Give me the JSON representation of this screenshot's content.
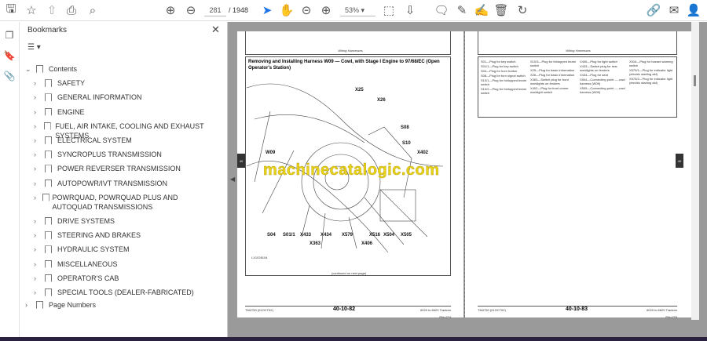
{
  "toolbar": {
    "page_current": "281",
    "page_total": "/ 1948",
    "zoom": "53%",
    "icons": [
      "save-icon",
      "bookmark-star-icon",
      "upload-icon",
      "print-icon",
      "search-icon",
      "page-up-icon",
      "page-down-icon",
      "select-cursor-icon",
      "hand-icon",
      "zoom-out-icon",
      "zoom-in-icon",
      "fit-page-icon",
      "scroll-mode-icon",
      "comment-icon",
      "pen-icon",
      "sign-icon",
      "delete-icon",
      "rotate-icon",
      "share-link-icon",
      "mail-icon",
      "account-icon"
    ],
    "accent": "#1a73e8"
  },
  "panel": {
    "title": "Bookmarks",
    "items": [
      {
        "label": "Contents",
        "level": 0,
        "expanded": true
      },
      {
        "label": "SAFETY",
        "level": 1
      },
      {
        "label": "GENERAL INFORMATION",
        "level": 1
      },
      {
        "label": "ENGINE",
        "level": 1
      },
      {
        "label": "FUEL, AIR INTAKE, COOLING AND EXHAUST SYSTEMS",
        "level": 1
      },
      {
        "label": "ELECTRICAL SYSTEM",
        "level": 1
      },
      {
        "label": "SYNCROPLUS TRANSMISSION",
        "level": 1
      },
      {
        "label": "POWER REVERSER TRANSMISSION",
        "level": 1
      },
      {
        "label": "AUTOPOWR/IVT TRANSMISSION",
        "level": 1
      },
      {
        "label": "POWRQUAD, POWRQUAD PLUS AND AUTOQUAD TRANSMISSIONS",
        "level": 1
      },
      {
        "label": "DRIVE SYSTEMS",
        "level": 1
      },
      {
        "label": "STEERING AND BRAKES",
        "level": 1
      },
      {
        "label": "HYDRAULIC SYSTEM",
        "level": 1
      },
      {
        "label": "MISCELLANEOUS",
        "level": 1
      },
      {
        "label": "OPERATOR'S CAB",
        "level": 1
      },
      {
        "label": "SPECIAL TOOLS (DEALER-FABRICATED)",
        "level": 1
      },
      {
        "label": "Page Numbers",
        "level": 0
      }
    ]
  },
  "left_page": {
    "header": "Wiring Harnesses",
    "title": "Removing and Installing Harness W09 — Cowl, with Stage I Engine to 97/68/EC (Open Operator's Station)",
    "labels": [
      "X25",
      "X26",
      "S08",
      "S10",
      "X402",
      "W09",
      "S04",
      "S01/1",
      "X433",
      "X434",
      "X579",
      "X516",
      "X504",
      "X505",
      "X363",
      "X406"
    ],
    "figure_id": "LX1026104",
    "continued": "(continued on next page)",
    "footer_left": "TM4750 (01OCT02)",
    "footer_center": "40-10-82",
    "footer_right": "6020 to 6620 Tractors",
    "footer_sub": "PN=274"
  },
  "right_page": {
    "header": "Wiring Harnesses",
    "legend": [
      [
        "S01—Plug for key switch",
        "S01/1—Plug for key switch",
        "S04—Plug for horn button",
        "S08—Plug for turn signal switch",
        "S10/1—Plug for foldupped beam switch",
        "S10/2—Plug for foldupped beam switch"
      ],
      [
        "S10/3—Plug for foldupped beam switch",
        "X25—Plug for basic information",
        "X26—Plug for basic information",
        "X363—Switch plug for front worklights on fenders",
        "X402—Plug for front corner worklight switch"
      ],
      [
        "X406—Plug for light switch",
        "X433—Switch plug for rear worklights on fenders",
        "X434—Plug for seat",
        "X504—Connecting point — cowl harness (W09)",
        "X505—Connecting point — cowl harness (W09)"
      ],
      [
        "X516—Plug for hazard warning switch",
        "X579/1—Plug for indicator light (electric starting aid)",
        "X579/2—Plug for indicator light (electric starting aid)"
      ]
    ],
    "footer_left": "TM4750 (01OCT02)",
    "footer_center": "40-10-83",
    "footer_right": "6020 to 6620 Tractors",
    "footer_sub": "PN=275"
  },
  "watermark": "machinecatalogic.com",
  "side_tab": "40"
}
